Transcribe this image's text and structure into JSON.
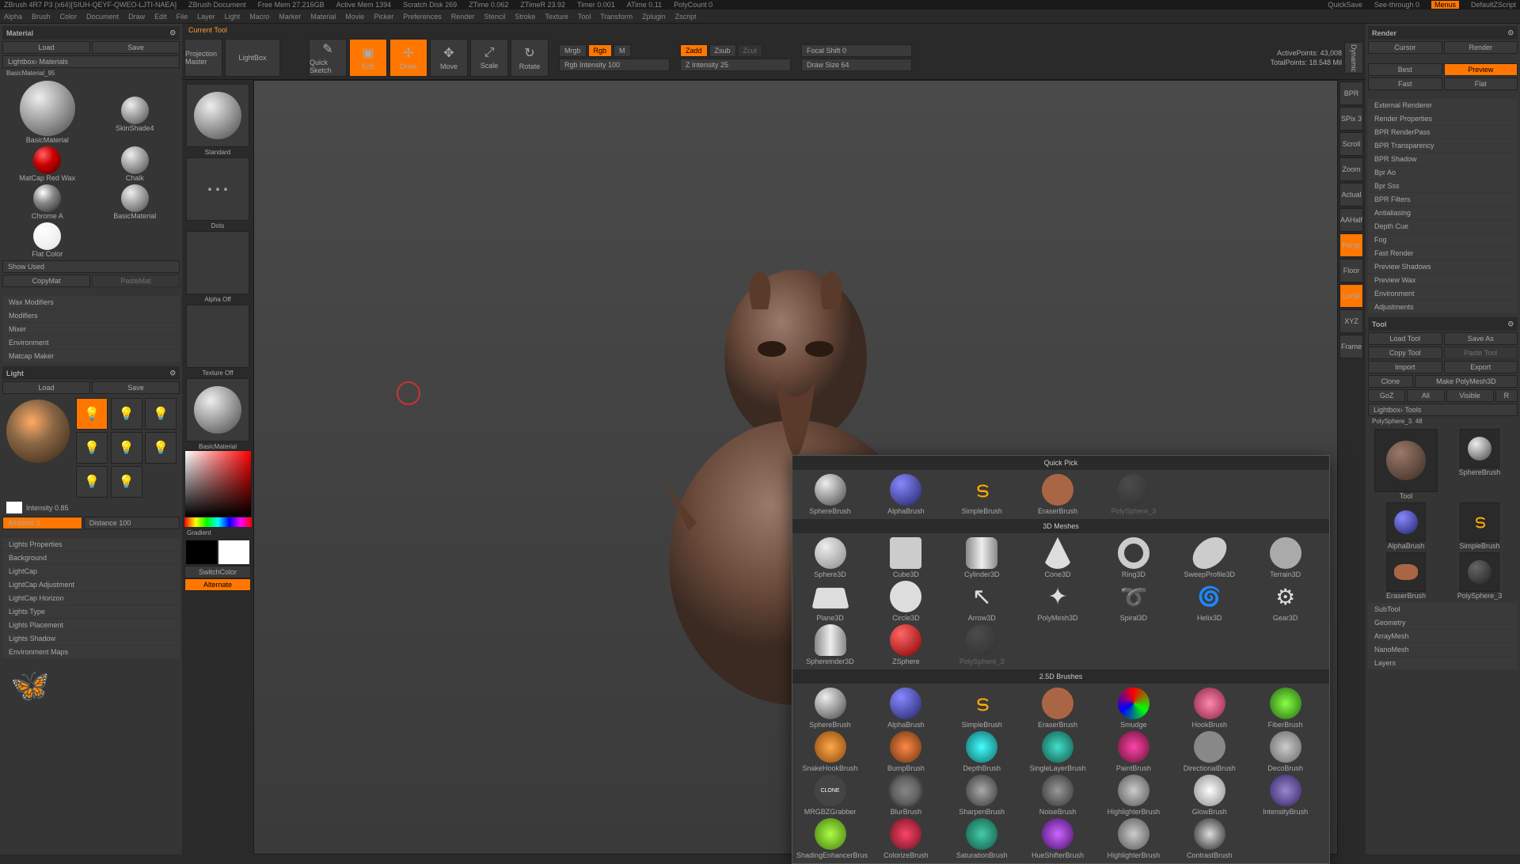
{
  "topbar": {
    "app": "ZBrush 4R7 P3 (x64)[SIUH-QEYF-QWEO-LJTI-NAEA]",
    "doc": "ZBrush Document",
    "freemem": "Free Mem 27.216GB",
    "activemem": "Active Mem 1394",
    "scratch": "Scratch Disk 269",
    "ztime": "ZTime 0.062",
    "ztimer": "ZTimeR 23.92",
    "timer": "Timer 0.001",
    "atime": "ATime 0.11",
    "polycount": "PolyCount 0",
    "quicksave": "QuickSave",
    "seethrough": "See-through 0",
    "menus": "Menus",
    "script": "DefaultZScript"
  },
  "menu": [
    "Alpha",
    "Brush",
    "Color",
    "Document",
    "Draw",
    "Edit",
    "File",
    "Layer",
    "Light",
    "Macro",
    "Marker",
    "Material",
    "Movie",
    "Picker",
    "Preferences",
    "Render",
    "Stencil",
    "Stroke",
    "Texture",
    "Tool",
    "Transform",
    "Zplugin",
    "Zscript"
  ],
  "material": {
    "title": "Material",
    "load": "Load",
    "save": "Save",
    "lightbox": "Lightbox› Materials",
    "current": "BasicMaterial_95",
    "items": [
      "BasicMaterial",
      "SkinShade4",
      "MatCap Red Wax",
      "Chalk",
      "Chrome A",
      "BasicMaterial",
      "Flat Color"
    ],
    "showused": "Show Used",
    "copymat": "CopyMat",
    "pastemat": "PasteMat",
    "sections": [
      "Wax Modifiers",
      "Modifiers",
      "Mixer",
      "Environment",
      "Matcap Maker"
    ]
  },
  "light": {
    "title": "Light",
    "load": "Load",
    "save": "Save",
    "intensity": "Intensity 0.85",
    "ambient": "Ambient 3",
    "distance": "Distance 100",
    "sections": [
      "Lights Properties",
      "Background",
      "LightCap",
      "LightCap Adjustment",
      "LightCap Horizon",
      "Lights Type",
      "Lights Placement",
      "Lights Shadow",
      "Environment Maps"
    ]
  },
  "toolbar": {
    "currenttool": "Current Tool",
    "projection": "Projection Master",
    "lightbox": "LightBox",
    "quicksketch": "Quick Sketch",
    "edit": "Edit",
    "draw": "Draw",
    "move": "Move",
    "scale": "Scale",
    "rotate": "Rotate",
    "mrgb": "Mrgb",
    "rgb": "Rgb",
    "m": "M",
    "rgbint": "Rgb Intensity 100",
    "zadd": "Zadd",
    "zsub": "Zsub",
    "zcut": "Zcut",
    "zint": "Z Intensity 25",
    "focal": "Focal Shift 0",
    "drawsize": "Draw Size 64",
    "activepoints": "ActivePoints: 43,008",
    "totalpoints": "TotalPoints: 18.548 Mil",
    "dynamic": "Dynamic"
  },
  "lefttools": {
    "standard": "Standard",
    "dots": "Dots",
    "alphaoff": "Alpha Off",
    "textureoff": "Texture Off",
    "basicmat": "BasicMaterial",
    "gradient": "Gradient",
    "switchcolor": "SwitchColor",
    "alternate": "Alternate"
  },
  "sidetools": [
    "BPR",
    "SPix 3",
    "Scroll",
    "Zoom",
    "Actual",
    "AAHalf",
    "Dynamic",
    "Persp",
    "Floor",
    "Local",
    "XYZ",
    "Frame"
  ],
  "render": {
    "title": "Render",
    "cursor": "Cursor",
    "renderbtn": "Render",
    "best": "Best",
    "preview": "Preview",
    "fast": "Fast",
    "flat": "Flat",
    "sections": [
      "External Renderer",
      "Render Properties",
      "BPR RenderPass",
      "BPR Transparency",
      "BPR Shadow",
      "Bpr Ao",
      "Bpr Sss",
      "BPR Filters",
      "Antialiasing",
      "Depth Cue",
      "Fog",
      "Fast Render",
      "Preview Shadows",
      "Preview Wax",
      "Environment",
      "Adjustments"
    ]
  },
  "tool": {
    "title": "Tool",
    "loadtool": "Load Tool",
    "saveas": "Save As",
    "copytool": "Copy Tool",
    "pastetool": "Paste Tool",
    "import": "Import",
    "export": "Export",
    "clone": "Clone",
    "makepoly": "Make PolyMesh3D",
    "goz": "GoZ",
    "all": "All",
    "visible": "Visible",
    "lightboxtools": "Lightbox› Tools",
    "current": "PolySphere_3. 48",
    "items": [
      "Tool",
      "SphereBrush",
      "AlphaBrush",
      "SimpleBrush",
      "EraserBrush",
      "PolySphere_3"
    ],
    "sections": [
      "SubTool",
      "Geometry",
      "ArrayMesh",
      "NanoMesh",
      "Layers"
    ]
  },
  "popup": {
    "quickpick": "Quick Pick",
    "quickitems": [
      "SphereBrush",
      "AlphaBrush",
      "SimpleBrush",
      "EraserBrush",
      "PolySphere_3"
    ],
    "meshes3d": "3D Meshes",
    "meshitems": [
      "Sphere3D",
      "Cube3D",
      "Cylinder3D",
      "Cone3D",
      "Ring3D",
      "SweepProfile3D",
      "Terrain3D",
      "Plane3D",
      "Circle3D",
      "Arrow3D",
      "PolyMesh3D",
      "Spiral3D",
      "Helix3D",
      "Gear3D",
      "Sphereinder3D",
      "ZSphere",
      "PolySphere_3"
    ],
    "brushes25d": "2.5D Brushes",
    "brushitems": [
      "SphereBrush",
      "AlphaBrush",
      "SimpleBrush",
      "EraserBrush",
      "Smudge",
      "HookBrush",
      "FiberBrush",
      "SnakeHookBrush",
      "BumpBrush",
      "DepthBrush",
      "SingleLayerBrush",
      "PaintBrush",
      "DirectionalBrush",
      "DecoBrush",
      "MRGBZGrabber",
      "BlurBrush",
      "SharpenBrush",
      "NoiseBrush",
      "HighlighterBrush",
      "GlowBrush",
      "IntensityBrush",
      "ShadingEnhancerBrus",
      "ColorizeBrush",
      "SaturationBrush",
      "HueShifterBrush",
      "HighlighterBrush",
      "ContrastBrush"
    ]
  }
}
